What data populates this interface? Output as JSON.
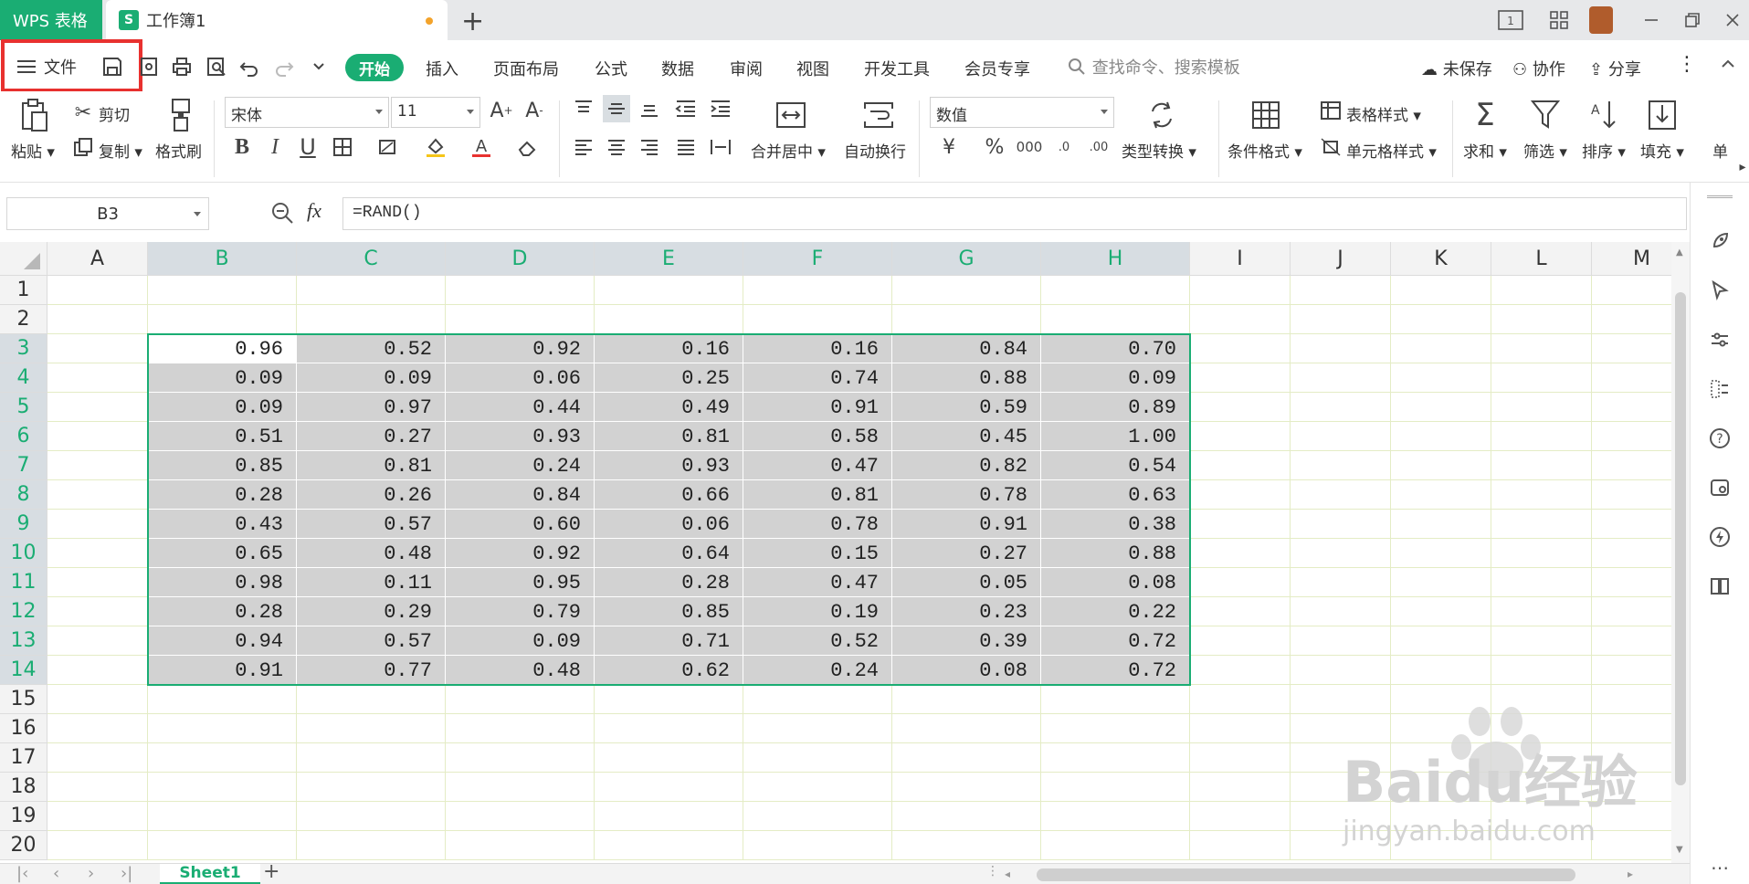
{
  "titlebar": {
    "app_tab": "WPS 表格",
    "doc_tab": "工作簿1",
    "doc_icon_letter": "S"
  },
  "menu": {
    "file": "文件",
    "tabs": [
      "开始",
      "插入",
      "页面布局",
      "公式",
      "数据",
      "审阅",
      "视图",
      "开发工具",
      "会员专享"
    ],
    "search_placeholder": "查找命令、搜索模板",
    "unsaved": "未保存",
    "collaborate": "协作",
    "share": "分享"
  },
  "ribbon": {
    "paste": "粘贴",
    "cut": "剪切",
    "copy": "复制",
    "format_painter": "格式刷",
    "font_name": "宋体",
    "font_size": "11",
    "merge_center": "合并居中",
    "wrap_text": "自动换行",
    "number_format": "数值",
    "type_convert": "类型转换",
    "conditional_format": "条件格式",
    "table_style": "表格样式",
    "cell_style": "单元格样式",
    "sum": "求和",
    "filter": "筛选",
    "sort": "排序",
    "fill": "填充",
    "cell_more": "单",
    "currency_symbol": "¥",
    "percent_symbol": "%",
    "thousands_symbol": "000"
  },
  "formula": {
    "cell_ref": "B3",
    "fx_label": "fx",
    "content": "=RAND()"
  },
  "grid": {
    "columns": [
      "A",
      "B",
      "C",
      "D",
      "E",
      "F",
      "G",
      "H",
      "I",
      "J",
      "K",
      "L",
      "M"
    ],
    "rows": [
      "1",
      "2",
      "3",
      "4",
      "5",
      "6",
      "7",
      "8",
      "9",
      "10",
      "11",
      "12",
      "13",
      "14",
      "15",
      "16",
      "17",
      "18",
      "19",
      "20"
    ],
    "data": [
      [
        "0.96",
        "0.52",
        "0.92",
        "0.16",
        "0.16",
        "0.84",
        "0.70"
      ],
      [
        "0.09",
        "0.09",
        "0.06",
        "0.25",
        "0.74",
        "0.88",
        "0.09"
      ],
      [
        "0.09",
        "0.97",
        "0.44",
        "0.49",
        "0.91",
        "0.59",
        "0.89"
      ],
      [
        "0.51",
        "0.27",
        "0.93",
        "0.81",
        "0.58",
        "0.45",
        "1.00"
      ],
      [
        "0.85",
        "0.81",
        "0.24",
        "0.93",
        "0.47",
        "0.82",
        "0.54"
      ],
      [
        "0.28",
        "0.26",
        "0.84",
        "0.66",
        "0.81",
        "0.78",
        "0.63"
      ],
      [
        "0.43",
        "0.57",
        "0.60",
        "0.06",
        "0.78",
        "0.91",
        "0.38"
      ],
      [
        "0.65",
        "0.48",
        "0.92",
        "0.64",
        "0.15",
        "0.27",
        "0.88"
      ],
      [
        "0.98",
        "0.11",
        "0.95",
        "0.28",
        "0.47",
        "0.05",
        "0.08"
      ],
      [
        "0.28",
        "0.29",
        "0.79",
        "0.85",
        "0.19",
        "0.23",
        "0.22"
      ],
      [
        "0.94",
        "0.57",
        "0.09",
        "0.71",
        "0.52",
        "0.39",
        "0.72"
      ],
      [
        "0.91",
        "0.77",
        "0.48",
        "0.62",
        "0.24",
        "0.08",
        "0.72"
      ]
    ]
  },
  "sheets": [
    "Sheet1"
  ],
  "watermark": {
    "brand": "Baidu经验",
    "url": "jingyan.baidu.com"
  },
  "colors": {
    "accent": "#1aad73",
    "highlight_box": "#e8312f",
    "selection_fill": "#d2d2d2"
  }
}
